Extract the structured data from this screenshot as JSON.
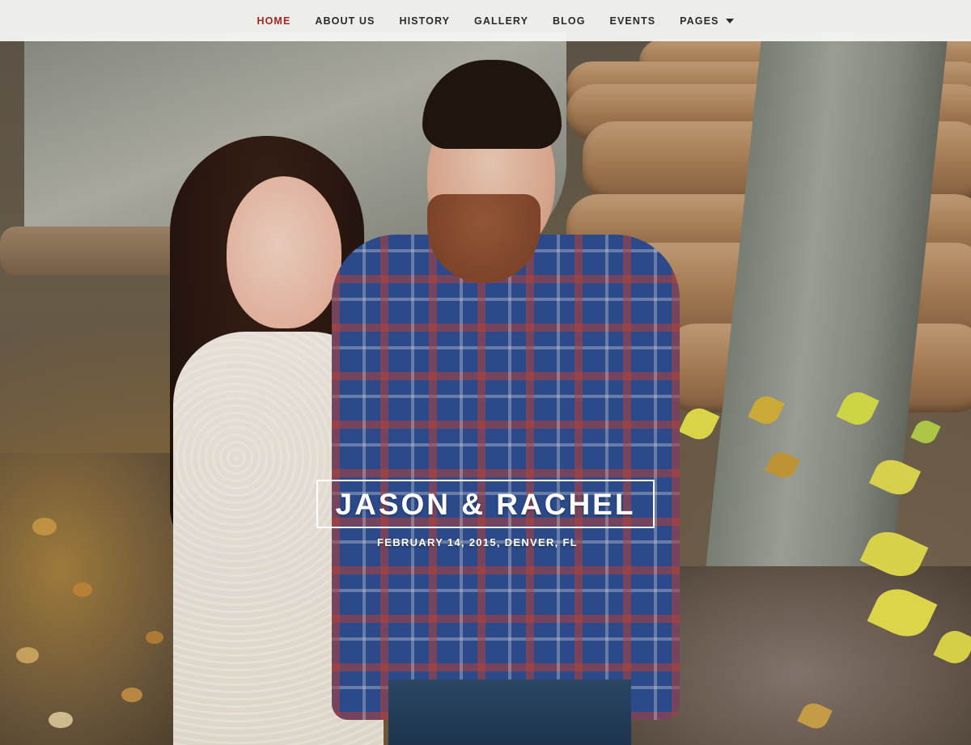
{
  "nav": {
    "items": [
      {
        "label": "HOME",
        "active": true
      },
      {
        "label": "ABOUT US",
        "active": false
      },
      {
        "label": "HISTORY",
        "active": false
      },
      {
        "label": "GALLERY",
        "active": false
      },
      {
        "label": "BLOG",
        "active": false
      },
      {
        "label": "EVENTS",
        "active": false
      },
      {
        "label": "PAGES",
        "active": false,
        "has_dropdown": true,
        "icon": "caret-down-icon"
      }
    ],
    "active_color": "#a22626",
    "text_color": "#2a2a2a"
  },
  "hero": {
    "title": "JASON & RACHEL",
    "subtitle": "FEBRUARY 14, 2015, DENVER, FL"
  }
}
